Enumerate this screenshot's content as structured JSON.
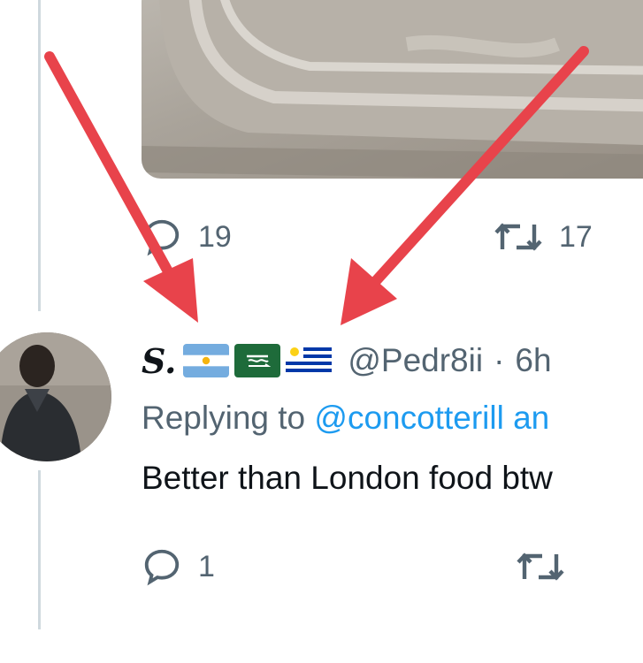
{
  "top_tweet": {
    "reply_count": "19",
    "retweet_count": "17"
  },
  "reply_tweet": {
    "display_name": "S.",
    "flags": [
      "flag-argentina-icon",
      "flag-saudi-arabia-icon",
      "flag-uruguay-icon"
    ],
    "handle": "@Pedr8ii",
    "separator": "·",
    "time": "6h",
    "replying_prefix": "Replying to ",
    "replying_mention": "@concotterill an",
    "text": "Better than London food btw",
    "reply_count": "1"
  },
  "colors": {
    "annotation_arrow": "#e8434b",
    "link": "#1d9bf0",
    "muted": "#536471",
    "thread_line": "#cfd9de"
  }
}
